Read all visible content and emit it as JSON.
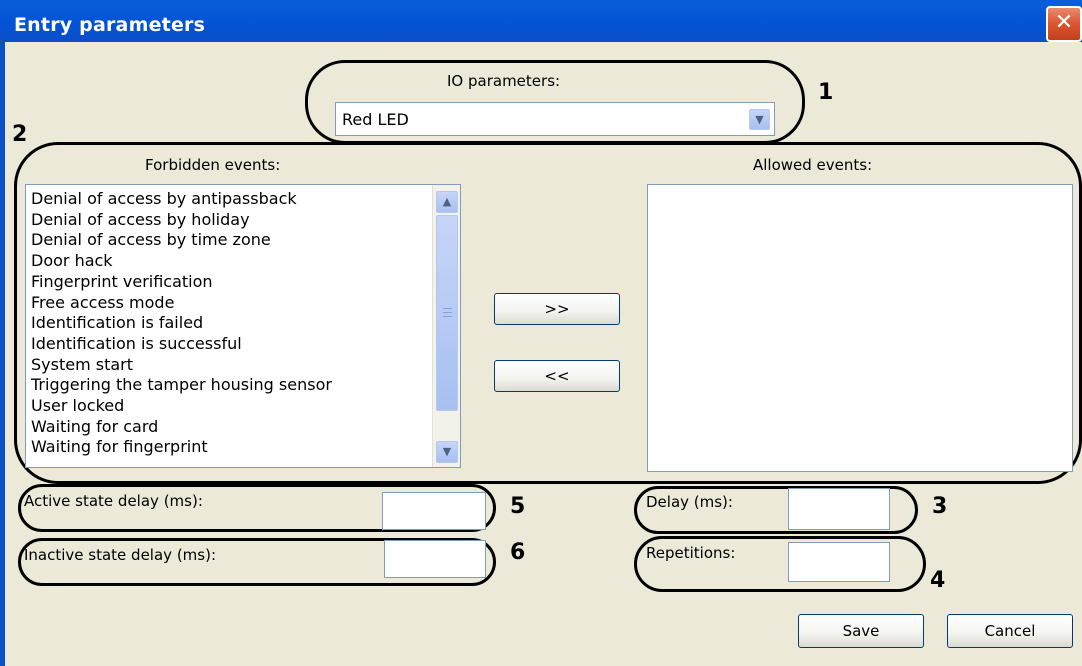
{
  "window": {
    "title": "Entry parameters",
    "close_glyph": "✕"
  },
  "io": {
    "label": "IO parameters:",
    "selected": "Red LED"
  },
  "forbidden": {
    "label": "Forbidden events:",
    "items": [
      "Denial of access by antipassback",
      "Denial of access by holiday",
      "Denial of access by time zone",
      "Door hack",
      "Fingerprint verification",
      "Free access mode",
      "Identification is failed",
      "Identification is successful",
      "System start",
      "Triggering the tamper housing sensor",
      "User locked",
      "Waiting for card",
      "Waiting for fingerprint"
    ]
  },
  "allowed": {
    "label": "Allowed events:",
    "items": []
  },
  "buttons": {
    "move_right": ">>",
    "move_left": "<<",
    "save": "Save",
    "cancel": "Cancel"
  },
  "fields": {
    "active_delay_label": "Active state delay (ms):",
    "inactive_delay_label": "Inactive state delay (ms):",
    "delay_label": "Delay (ms):",
    "repetitions_label": "Repetitions:"
  },
  "callouts": [
    "1",
    "2",
    "3",
    "4",
    "5",
    "6"
  ],
  "colors": {
    "titlebar": "#0353d6",
    "dialog_bg": "#ece9d8",
    "close": "#d9542f",
    "input_border": "#7f9db9"
  }
}
